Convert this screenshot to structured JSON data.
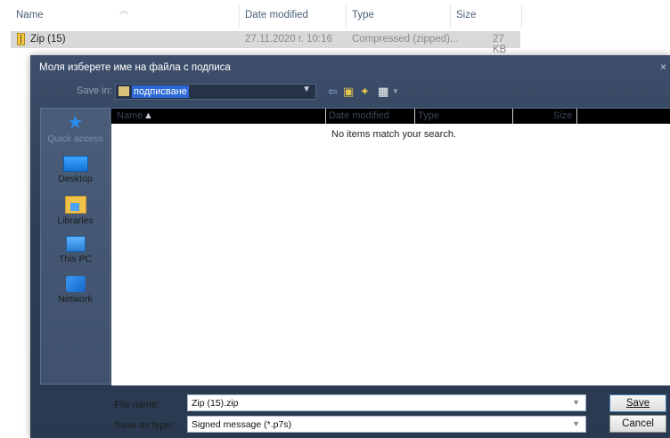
{
  "background_explorer": {
    "columns": {
      "name": "Name",
      "date_modified": "Date modified",
      "type": "Type",
      "size": "Size"
    },
    "row": {
      "name": "Zip (15)",
      "date_modified": "27.11.2020 г. 10:16",
      "type": "Compressed (zipped)...",
      "size": "27 KB"
    }
  },
  "dialog": {
    "title": "Моля изберете име на файла с подписа",
    "close_glyph": "×",
    "save_in_label": "Save in:",
    "save_in_value": "подписване",
    "places": {
      "quick_access": "Quick access",
      "desktop": "Desktop",
      "libraries": "Libraries",
      "this_pc": "This PC",
      "network": "Network"
    },
    "file_list": {
      "columns": {
        "name": "Name",
        "date_modified": "Date modified",
        "type": "Type",
        "size": "Size"
      },
      "empty_message": "No items match your search."
    },
    "file_name_label": "File name:",
    "file_name_value": "Zip (15).zip",
    "save_as_type_label": "Save as type:",
    "save_as_type_value": "Signed message (*.p7s)",
    "save_button_label": "Save",
    "cancel_button_label": "Cancel"
  },
  "icons": [
    "sort-up-icon",
    "zip-folder-icon",
    "folder-icon",
    "back-arrow-icon",
    "up-folder-icon",
    "new-folder-icon",
    "view-menu-icon",
    "star-icon",
    "desktop-icon",
    "libraries-icon",
    "computer-icon",
    "network-icon"
  ]
}
